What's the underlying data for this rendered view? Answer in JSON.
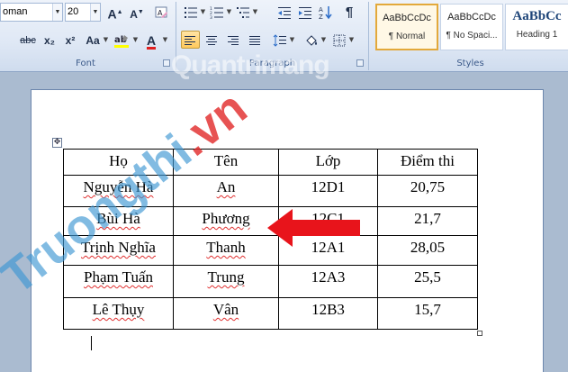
{
  "ribbon": {
    "font_group": {
      "label": "Font",
      "font_name": "oman",
      "font_size": "20",
      "grow_label": "A",
      "shrink_label": "A",
      "strikethrough_label": "abc",
      "subscript_label": "x₂",
      "superscript_label": "x²",
      "change_case_label": "Aa",
      "font_color_label": "A",
      "font_color": "#e02020",
      "highlight_color": "#ffff00"
    },
    "paragraph_group": {
      "label": "Paragraph"
    },
    "styles_group": {
      "label": "Styles",
      "items": [
        {
          "sample": "AaBbCcDc",
          "name": "¶ Normal",
          "selected": true
        },
        {
          "sample": "AaBbCcDc",
          "name": "¶ No Spaci...",
          "selected": false
        },
        {
          "sample": "AaBbCc",
          "name": "Heading 1",
          "selected": false
        }
      ]
    }
  },
  "watermark": {
    "logo": "Quantrimang",
    "diagonal_blue": "Truongthi",
    "diagonal_red": ".vn"
  },
  "table": {
    "headers": [
      "Họ",
      "Tên",
      "Lớp",
      "Điểm thi"
    ],
    "rows": [
      [
        "Nguyễn Hà",
        "An",
        "12D1",
        "20,75"
      ],
      [
        "Bùi Hà",
        "Phương",
        "12C1",
        "21,7"
      ],
      [
        "Trịnh Nghĩa",
        "Thanh",
        "12A1",
        "28,05"
      ],
      [
        "Phạm Tuấn",
        "Trung",
        "12A3",
        "25,5"
      ],
      [
        "Lê Thụy",
        "Vân",
        "12B3",
        "15,7"
      ]
    ]
  },
  "colors": {
    "ribbon_bg": "#dfe8f5",
    "workspace_bg": "#aabbd0",
    "arrow": "#e8141b"
  }
}
